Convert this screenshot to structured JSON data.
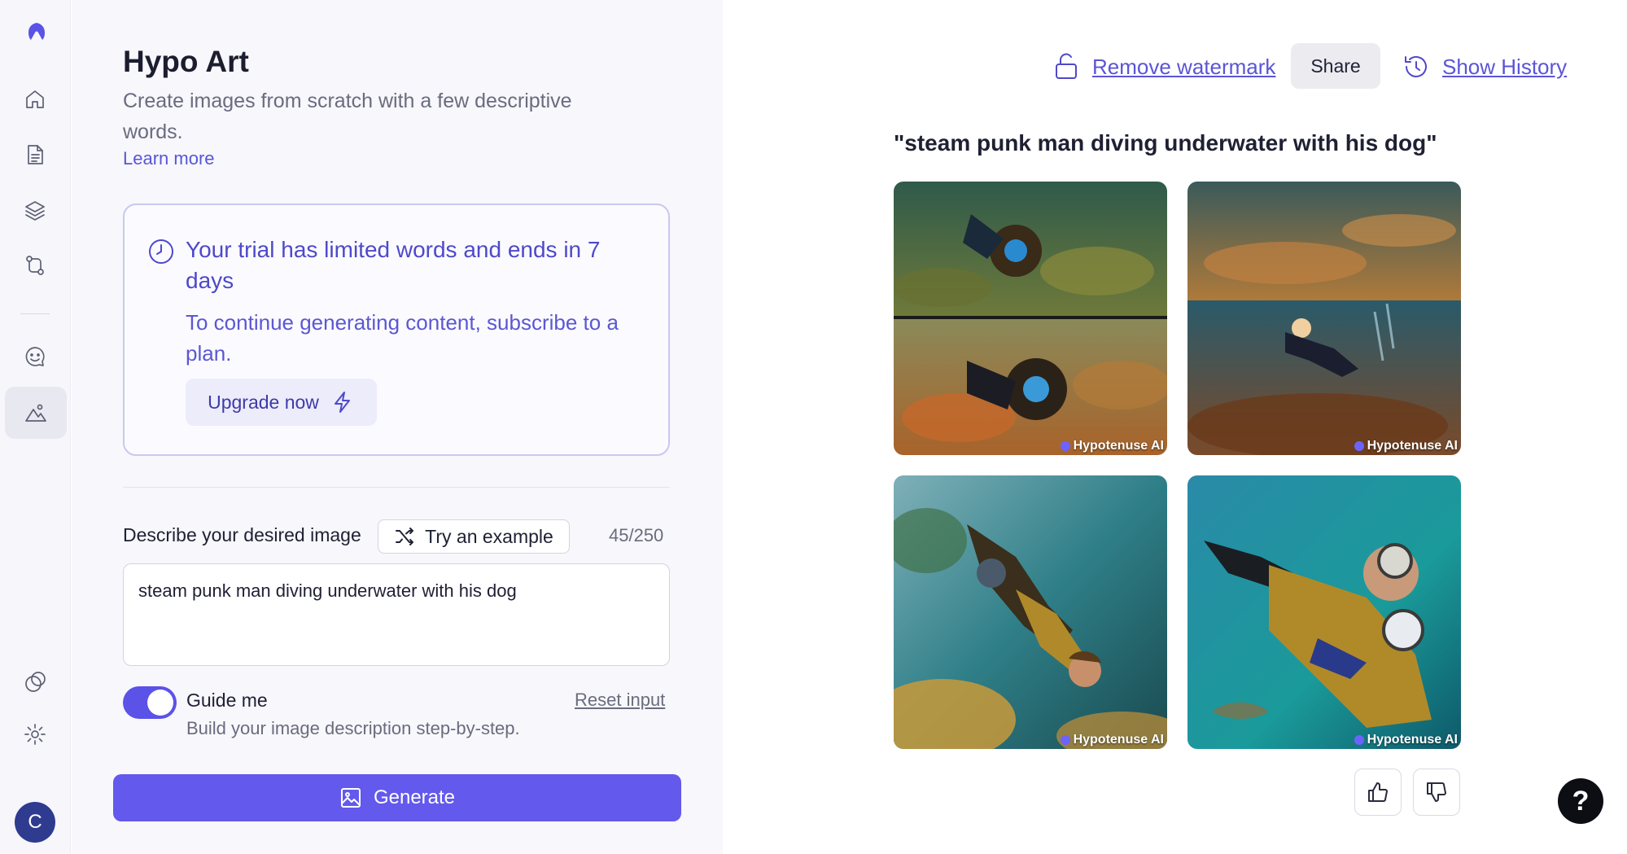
{
  "nav": {
    "items": [
      {
        "icon": "logo-icon"
      },
      {
        "icon": "home-icon"
      },
      {
        "icon": "document-icon"
      },
      {
        "icon": "layers-icon"
      },
      {
        "icon": "workflow-icon"
      },
      {
        "icon": "chat-icon"
      },
      {
        "icon": "image-art-icon",
        "active": true
      },
      {
        "icon": "circles-icon"
      },
      {
        "icon": "gear-icon"
      }
    ],
    "avatar_initial": "C"
  },
  "panel": {
    "title": "Hypo Art",
    "subtitle": "Create images from scratch with a few descriptive words.",
    "learn_more": "Learn more",
    "trial": {
      "heading": "Your trial has limited words and ends in 7 days",
      "body": "To continue generating content, subscribe to a plan.",
      "upgrade_label": "Upgrade now"
    },
    "describe_label": "Describe your desired image",
    "try_example_label": "Try an example",
    "char_count": "45/250",
    "prompt_value": "steam punk man diving underwater with his dog",
    "guide": {
      "label": "Guide me",
      "sub": "Build your image description step-by-step.",
      "enabled": true
    },
    "reset_label": "Reset input",
    "generate_label": "Generate"
  },
  "results": {
    "remove_watermark": "Remove watermark",
    "share_label": "Share",
    "show_history": "Show History",
    "prompt_title": "\"steam punk man diving underwater with his dog\"",
    "watermark_text": "Hypotenuse AI",
    "images": [
      {
        "name": "generated-image-1"
      },
      {
        "name": "generated-image-2"
      },
      {
        "name": "generated-image-3"
      },
      {
        "name": "generated-image-4"
      }
    ]
  },
  "colors": {
    "accent": "#6359ec",
    "accent_text": "#5a55d6",
    "panel_bg": "#f7f7fc"
  }
}
